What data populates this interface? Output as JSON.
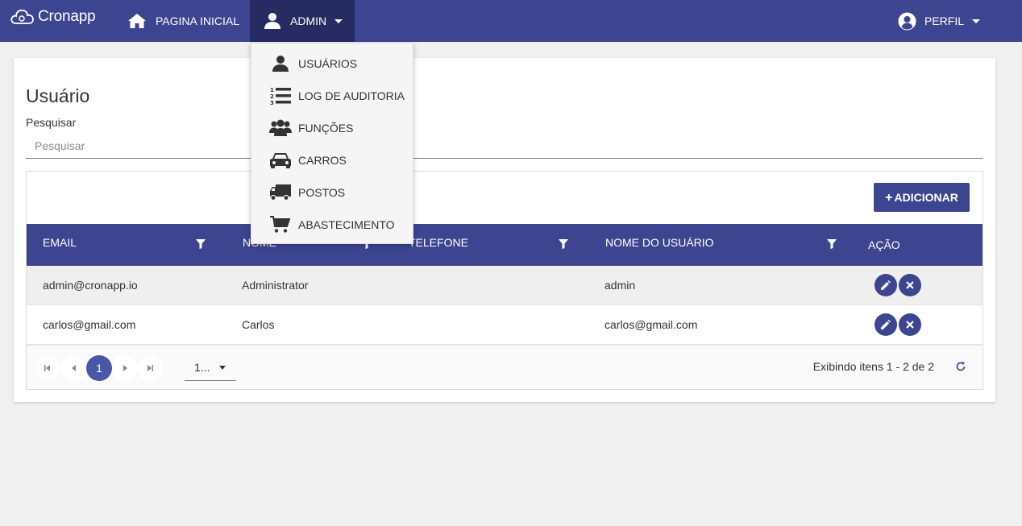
{
  "app": {
    "brand": "Cronapp"
  },
  "navbar": {
    "home_label": "PAGINA INICIAL",
    "admin_label": "ADMIN",
    "profile_label": "PERFIL"
  },
  "admin_menu": {
    "items": [
      {
        "label": "USUÁRIOS",
        "icon": "user-icon"
      },
      {
        "label": "LOG DE AUDITORIA",
        "icon": "numbered-list-icon"
      },
      {
        "label": "FUNÇÕES",
        "icon": "users-group-icon"
      },
      {
        "label": "CARROS",
        "icon": "car-icon"
      },
      {
        "label": "POSTOS",
        "icon": "truck-icon"
      },
      {
        "label": "ABASTECIMENTO",
        "icon": "cart-icon"
      }
    ]
  },
  "page": {
    "title": "Usuário",
    "search_label": "Pesquisar",
    "search_placeholder": "Pesquisar",
    "search_value": ""
  },
  "grid": {
    "add_label": "ADICIONAR",
    "columns": [
      "EMAIL",
      "NOME",
      "TELEFONE",
      "NOME DO USUÁRIO",
      "AÇÃO"
    ],
    "rows": [
      {
        "email": "admin@cronapp.io",
        "nome": "Administrator",
        "telefone": "",
        "usuario": "admin"
      },
      {
        "email": "carlos@gmail.com",
        "nome": "Carlos",
        "telefone": "",
        "usuario": "carlos@gmail.com"
      }
    ],
    "pager": {
      "current_page": "1",
      "page_size": "1...",
      "info": "Exibindo itens 1 - 2 de 2"
    }
  },
  "colors": {
    "primary": "#3d4590",
    "primary_dark": "#262c62",
    "page_active": "#4a56a8"
  }
}
